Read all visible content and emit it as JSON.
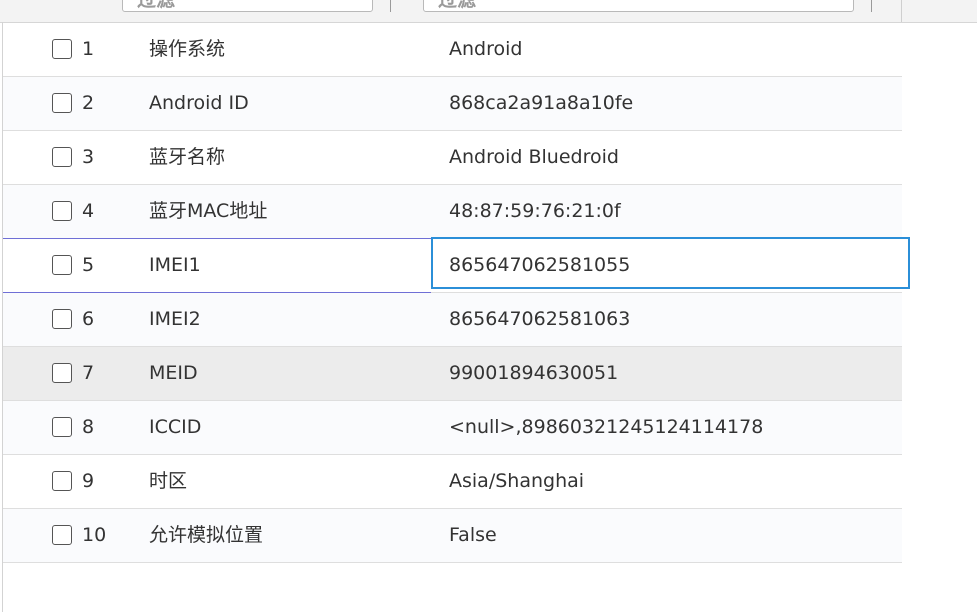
{
  "filters": {
    "col1_placeholder": "过滤",
    "col2_placeholder": "过滤"
  },
  "table": {
    "rows": [
      {
        "index": "1",
        "name": "操作系统",
        "value": "Android"
      },
      {
        "index": "2",
        "name": "Android ID",
        "value": "868ca2a91a8a10fe"
      },
      {
        "index": "3",
        "name": "蓝牙名称",
        "value": "Android Bluedroid"
      },
      {
        "index": "4",
        "name": "蓝牙MAC地址",
        "value": "48:87:59:76:21:0f"
      },
      {
        "index": "5",
        "name": "IMEI1",
        "value": "865647062581055"
      },
      {
        "index": "6",
        "name": "IMEI2",
        "value": "865647062581063"
      },
      {
        "index": "7",
        "name": "MEID",
        "value": "99001894630051"
      },
      {
        "index": "8",
        "name": "ICCID",
        "value": "<null>,89860321245124114178"
      },
      {
        "index": "9",
        "name": "时区",
        "value": "Asia/Shanghai"
      },
      {
        "index": "10",
        "name": "允许模拟位置",
        "value": "False"
      }
    ],
    "selected_row": 5,
    "hovered_row": 7
  },
  "colors": {
    "selection_border": "#6f6fd6",
    "focus_cell_border": "#2b8fd8",
    "hover_row_bg": "#ececec"
  }
}
